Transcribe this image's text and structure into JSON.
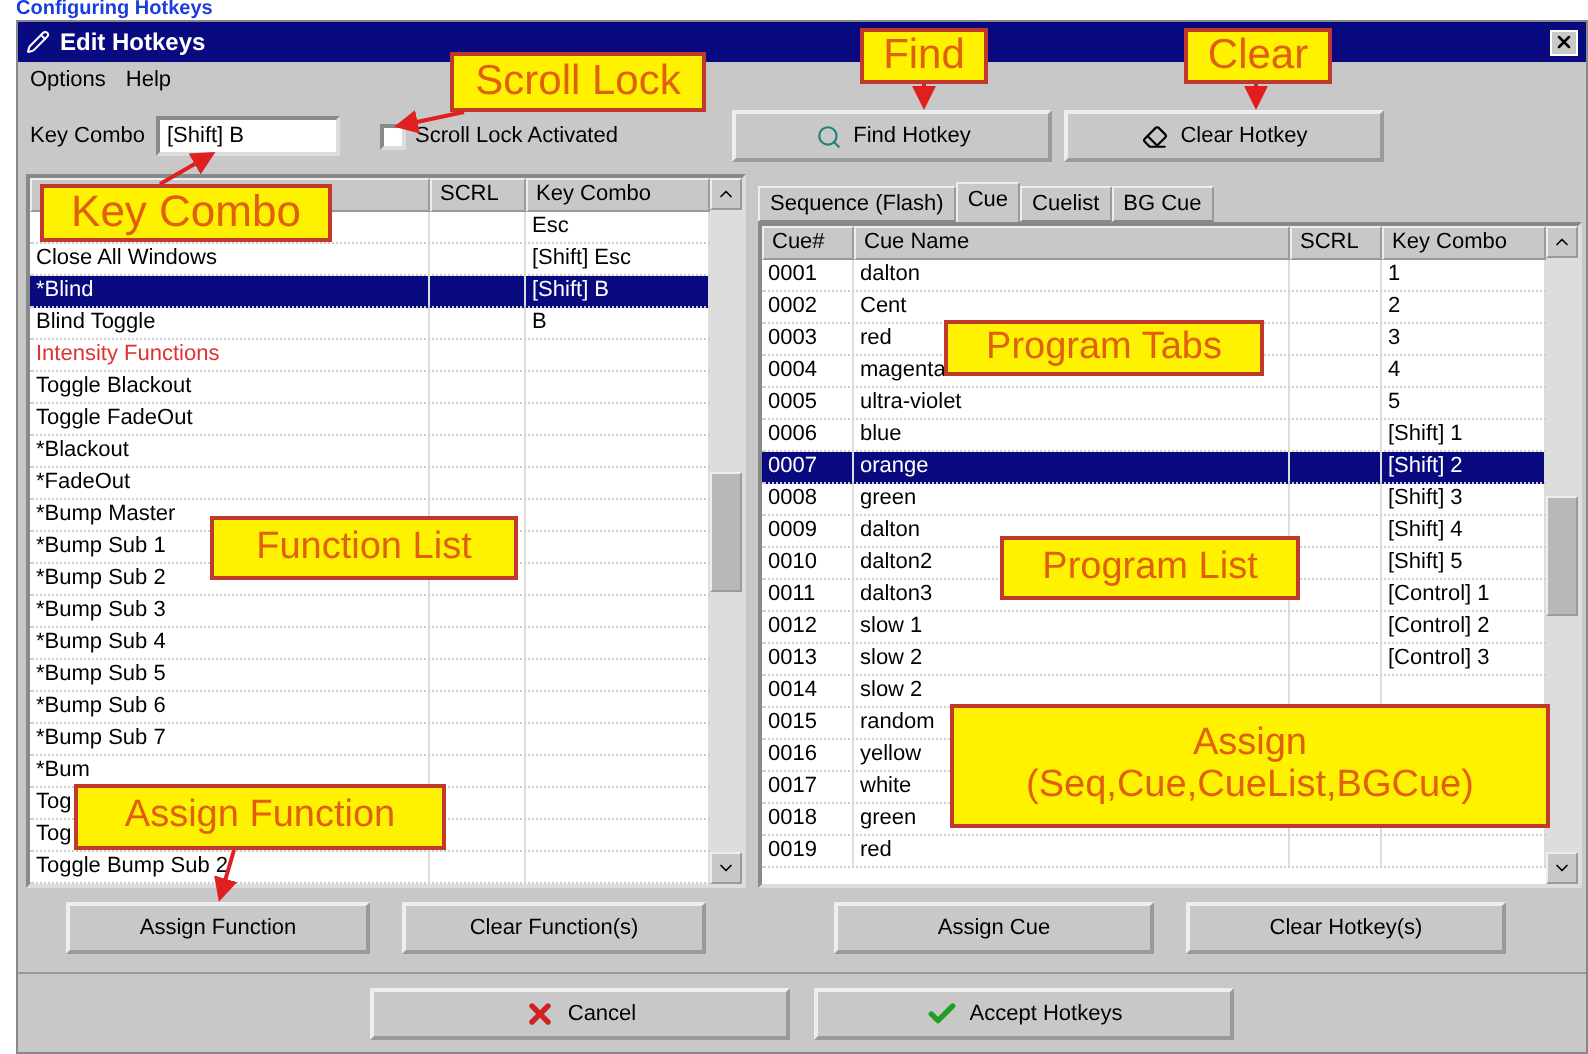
{
  "heading": "Configuring Hotkeys",
  "window": {
    "title": "Edit Hotkeys"
  },
  "menu": [
    "Options",
    "Help"
  ],
  "key_combo": {
    "label": "Key Combo",
    "value": "[Shift] B"
  },
  "scroll_lock": {
    "label": "Scroll Lock Activated",
    "checked": false
  },
  "top_buttons": [
    {
      "kind": "find",
      "label": "Find Hotkey"
    },
    {
      "kind": "clear",
      "label": "Clear Hotkey"
    }
  ],
  "function_list": {
    "columns": [
      "SCRL",
      "Key Combo"
    ],
    "rows": [
      {
        "name": "",
        "scrl": "",
        "key": "Esc",
        "selected": false,
        "kind": "item"
      },
      {
        "name": "Close All Windows",
        "scrl": "",
        "key": "[Shift] Esc",
        "selected": false,
        "kind": "item"
      },
      {
        "name": "*Blind",
        "scrl": "",
        "key": "[Shift] B",
        "selected": true,
        "kind": "item"
      },
      {
        "name": "Blind Toggle",
        "scrl": "",
        "key": "B",
        "selected": false,
        "kind": "item"
      },
      {
        "name": "Intensity Functions",
        "scrl": "",
        "key": "",
        "selected": false,
        "kind": "group"
      },
      {
        "name": "Toggle Blackout",
        "scrl": "",
        "key": "",
        "selected": false,
        "kind": "item"
      },
      {
        "name": "Toggle FadeOut",
        "scrl": "",
        "key": "",
        "selected": false,
        "kind": "item"
      },
      {
        "name": "*Blackout",
        "scrl": "",
        "key": "",
        "selected": false,
        "kind": "item"
      },
      {
        "name": "*FadeOut",
        "scrl": "",
        "key": "",
        "selected": false,
        "kind": "item"
      },
      {
        "name": "*Bump Master",
        "scrl": "",
        "key": "",
        "selected": false,
        "kind": "item"
      },
      {
        "name": "*Bump Sub 1",
        "scrl": "",
        "key": "",
        "selected": false,
        "kind": "item"
      },
      {
        "name": "*Bump Sub 2",
        "scrl": "",
        "key": "",
        "selected": false,
        "kind": "item"
      },
      {
        "name": "*Bump Sub 3",
        "scrl": "",
        "key": "",
        "selected": false,
        "kind": "item"
      },
      {
        "name": "*Bump Sub 4",
        "scrl": "",
        "key": "",
        "selected": false,
        "kind": "item"
      },
      {
        "name": "*Bump Sub 5",
        "scrl": "",
        "key": "",
        "selected": false,
        "kind": "item"
      },
      {
        "name": "*Bump Sub 6",
        "scrl": "",
        "key": "",
        "selected": false,
        "kind": "item"
      },
      {
        "name": "*Bump Sub 7",
        "scrl": "",
        "key": "",
        "selected": false,
        "kind": "item"
      },
      {
        "name": "*Bum",
        "scrl": "",
        "key": "",
        "selected": false,
        "kind": "item"
      },
      {
        "name": "Tog",
        "scrl": "",
        "key": "",
        "selected": false,
        "kind": "item"
      },
      {
        "name": "Tog",
        "scrl": "",
        "key": "",
        "selected": false,
        "kind": "item"
      },
      {
        "name": "Toggle Bump Sub 2",
        "scrl": "",
        "key": "",
        "selected": false,
        "kind": "item"
      }
    ]
  },
  "function_buttons": [
    "Assign Function",
    "Clear Function(s)"
  ],
  "program_tabs": [
    {
      "label": "Sequence (Flash)",
      "selected": false
    },
    {
      "label": "Cue",
      "selected": true
    },
    {
      "label": "Cuelist",
      "selected": false
    },
    {
      "label": "BG Cue",
      "selected": false
    }
  ],
  "program_list": {
    "columns": [
      "Cue#",
      "Cue Name",
      "SCRL",
      "Key Combo"
    ],
    "rows": [
      {
        "num": "0001",
        "name": "dalton",
        "scrl": "",
        "key": "1",
        "selected": false
      },
      {
        "num": "0002",
        "name": "Cent",
        "scrl": "",
        "key": "2",
        "selected": false
      },
      {
        "num": "0003",
        "name": "red",
        "scrl": "",
        "key": "3",
        "selected": false
      },
      {
        "num": "0004",
        "name": "magenta",
        "scrl": "",
        "key": "4",
        "selected": false
      },
      {
        "num": "0005",
        "name": "ultra-violet",
        "scrl": "",
        "key": "5",
        "selected": false
      },
      {
        "num": "0006",
        "name": "blue",
        "scrl": "",
        "key": "[Shift] 1",
        "selected": false
      },
      {
        "num": "0007",
        "name": "orange",
        "scrl": "",
        "key": "[Shift] 2",
        "selected": true
      },
      {
        "num": "0008",
        "name": "green",
        "scrl": "",
        "key": "[Shift] 3",
        "selected": false
      },
      {
        "num": "0009",
        "name": "dalton",
        "scrl": "",
        "key": "[Shift] 4",
        "selected": false
      },
      {
        "num": "0010",
        "name": "dalton2",
        "scrl": "",
        "key": "[Shift] 5",
        "selected": false
      },
      {
        "num": "0011",
        "name": "dalton3",
        "scrl": "",
        "key": "[Control] 1",
        "selected": false
      },
      {
        "num": "0012",
        "name": "slow 1",
        "scrl": "",
        "key": "[Control] 2",
        "selected": false
      },
      {
        "num": "0013",
        "name": "slow 2",
        "scrl": "",
        "key": "[Control] 3",
        "selected": false
      },
      {
        "num": "0014",
        "name": "slow 2",
        "scrl": "",
        "key": "",
        "selected": false
      },
      {
        "num": "0015",
        "name": "random",
        "scrl": "",
        "key": "",
        "selected": false
      },
      {
        "num": "0016",
        "name": "yellow",
        "scrl": "",
        "key": "",
        "selected": false
      },
      {
        "num": "0017",
        "name": "white",
        "scrl": "",
        "key": "",
        "selected": false
      },
      {
        "num": "0018",
        "name": "green",
        "scrl": "",
        "key": "",
        "selected": false
      },
      {
        "num": "0019",
        "name": "red",
        "scrl": "",
        "key": "",
        "selected": false
      }
    ]
  },
  "program_buttons": [
    "Assign Cue",
    "Clear Hotkey(s)"
  ],
  "bottom_buttons": [
    {
      "kind": "cancel",
      "label": "Cancel"
    },
    {
      "kind": "accept",
      "label": "Accept Hotkeys"
    }
  ],
  "annotations": [
    "Scroll Lock",
    "Find",
    "Clear",
    "Key Combo",
    "Function List",
    "Program Tabs",
    "Program List",
    "Assign\n(Seq,Cue,CueList,BGCue)",
    "Assign Function"
  ]
}
